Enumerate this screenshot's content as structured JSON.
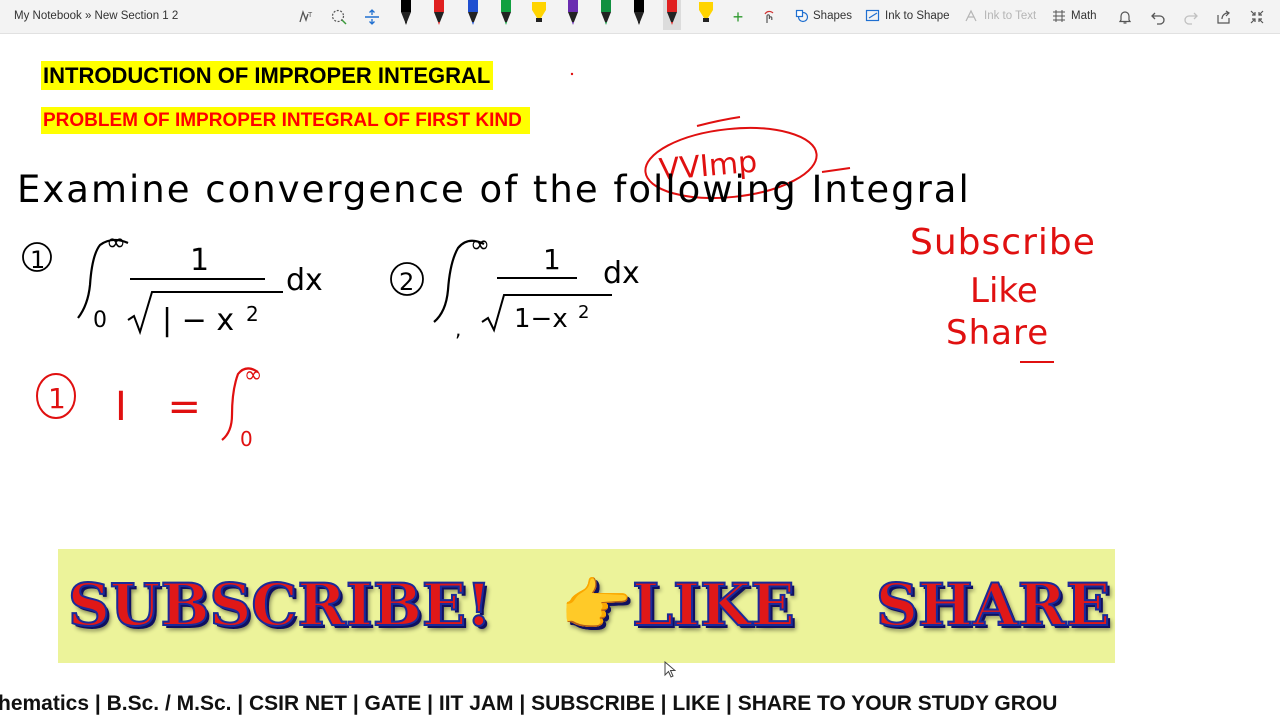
{
  "toolbar": {
    "breadcrumb": "My Notebook » New Section 1 2",
    "shapes_label": "Shapes",
    "ink_to_shape_label": "Ink to Shape",
    "ink_to_text_label": "Ink to Text",
    "math_label": "Math",
    "pen_colors": [
      "#000000",
      "#e02020",
      "#1f4fd0",
      "#10a040",
      "#ffd400",
      "#6a2cb0",
      "#109040",
      "#000000",
      "#e02020",
      "#ffd400"
    ]
  },
  "note": {
    "title": "INTRODUCTION OF IMPROPER INTEGRAL",
    "subtitle": "PROBLEM  OF IMPROPER INTEGRAL  OF FIRST KIND",
    "ink_black_line": "Examine convergence of the following Integral",
    "ink_red_note": "VVImp",
    "side_note": [
      "Subscribe",
      "Like",
      "Share"
    ],
    "problem_1_label": "1",
    "problem_2_label": "2",
    "solution_label": "I ="
  },
  "banner": {
    "subscribe": "SUBSCRIBE!",
    "like": "👉LIKE",
    "share": "SHARE",
    "bg_color": "#ecf39a"
  },
  "ticker": {
    "text": "hematics | B.Sc. / M.Sc. | CSIR NET | GATE | IIT JAM | SUBSCRIBE | LIKE | SHARE TO YOUR STUDY GROU"
  },
  "colors": {
    "ink_black": "#000000",
    "ink_red": "#e01010",
    "highlight": "#ffff00"
  }
}
